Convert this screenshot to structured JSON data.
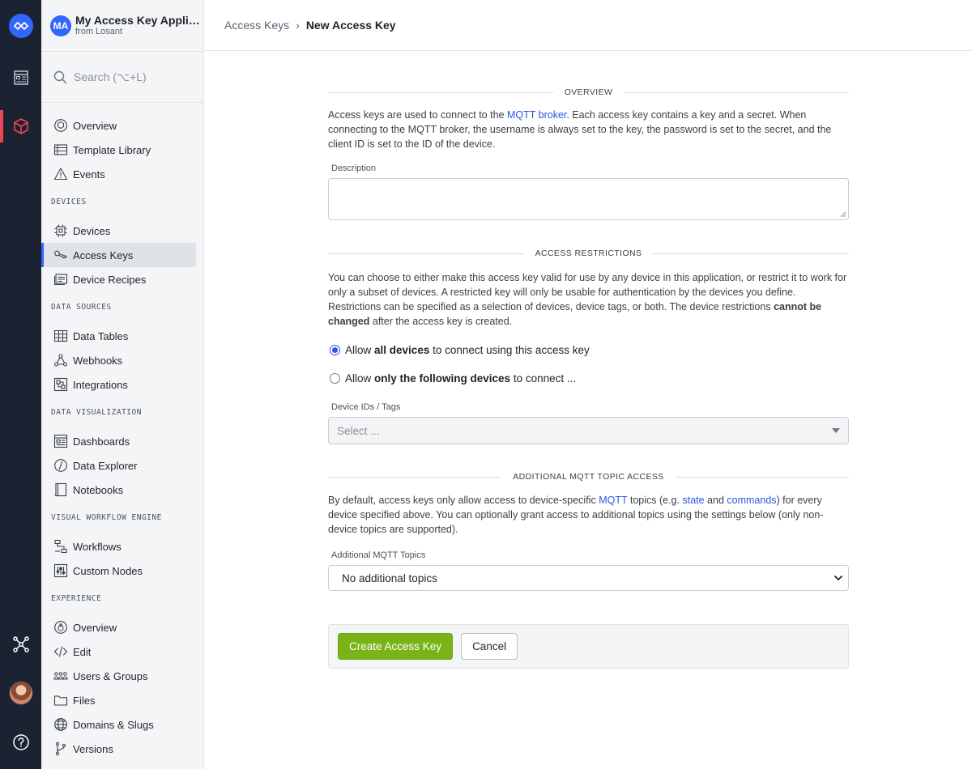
{
  "app": {
    "badge": "MA",
    "title": "My Access Key Application",
    "subtitle": "from Losant"
  },
  "search": {
    "placeholder": "Search (⌥+L)"
  },
  "sidebar": {
    "top": [
      {
        "label": "Overview",
        "icon": "overview-icon"
      },
      {
        "label": "Template Library",
        "icon": "template-library-icon"
      },
      {
        "label": "Events",
        "icon": "warning-icon"
      }
    ],
    "sections": [
      {
        "title": "DEVICES",
        "items": [
          {
            "label": "Devices",
            "icon": "chip-icon"
          },
          {
            "label": "Access Keys",
            "icon": "key-icon",
            "active": true
          },
          {
            "label": "Device Recipes",
            "icon": "recipe-icon"
          }
        ]
      },
      {
        "title": "DATA SOURCES",
        "items": [
          {
            "label": "Data Tables",
            "icon": "table-icon"
          },
          {
            "label": "Webhooks",
            "icon": "webhook-icon"
          },
          {
            "label": "Integrations",
            "icon": "integration-icon"
          }
        ]
      },
      {
        "title": "DATA VISUALIZATION",
        "items": [
          {
            "label": "Dashboards",
            "icon": "dashboard-icon"
          },
          {
            "label": "Data Explorer",
            "icon": "compass-icon"
          },
          {
            "label": "Notebooks",
            "icon": "notebook-icon"
          }
        ]
      },
      {
        "title": "VISUAL WORKFLOW ENGINE",
        "items": [
          {
            "label": "Workflows",
            "icon": "workflow-icon"
          },
          {
            "label": "Custom Nodes",
            "icon": "sliders-icon"
          }
        ]
      },
      {
        "title": "EXPERIENCE",
        "items": [
          {
            "label": "Overview",
            "icon": "flame-icon"
          },
          {
            "label": "Edit",
            "icon": "code-icon"
          },
          {
            "label": "Users & Groups",
            "icon": "users-icon"
          },
          {
            "label": "Files",
            "icon": "folder-icon"
          },
          {
            "label": "Domains & Slugs",
            "icon": "globe-icon"
          },
          {
            "label": "Versions",
            "icon": "branch-icon"
          }
        ]
      }
    ]
  },
  "breadcrumb": {
    "parent": "Access Keys",
    "separator": "›",
    "current": "New Access Key"
  },
  "form": {
    "overview_title": "OVERVIEW",
    "overview_text": {
      "before": "Access keys are used to connect to the ",
      "link": "MQTT broker",
      "after": ". Each access key contains a key and a secret. When connecting to the MQTT broker, the username is always set to the key, the password is set to the secret, and the client ID is set to the ID of the device."
    },
    "description_label": "Description",
    "restrictions_title": "ACCESS RESTRICTIONS",
    "restrictions_text": {
      "before": "You can choose to either make this access key valid for use by any device in this application, or restrict it to work for only a subset of devices. A restricted key will only be usable for authentication by the devices you define. Restrictions can be specified as a selection of devices, device tags, or both. The device restrictions ",
      "bold": "cannot be changed",
      "after": " after the access key is created."
    },
    "radio_all": {
      "pre": "Allow ",
      "bold": "all devices",
      "post": " to connect using this access key",
      "selected": true
    },
    "radio_some": {
      "pre": "Allow ",
      "bold": "only the following devices",
      "post": " to connect ...",
      "selected": false
    },
    "device_ids_label": "Device IDs / Tags",
    "device_ids_placeholder": "Select ...",
    "mqtt_title": "ADDITIONAL MQTT TOPIC ACCESS",
    "mqtt_text": {
      "p1": "By default, access keys only allow access to device-specific ",
      "link1": "MQTT",
      "p2": " topics (e.g. ",
      "link2": "state",
      "p3": " and ",
      "link3": "commands",
      "p4": ") for every device specified above. You can optionally grant access to additional topics using the settings below (only non-device topics are supported)."
    },
    "mqtt_topics_label": "Additional MQTT Topics",
    "mqtt_topics_value": "No additional topics",
    "create_label": "Create Access Key",
    "cancel_label": "Cancel"
  },
  "colors": {
    "accent": "#3366ff",
    "rail": "#1b2333",
    "primary_button": "#7ab317",
    "link": "#2a55e5",
    "rail_active": "#e8474f"
  }
}
